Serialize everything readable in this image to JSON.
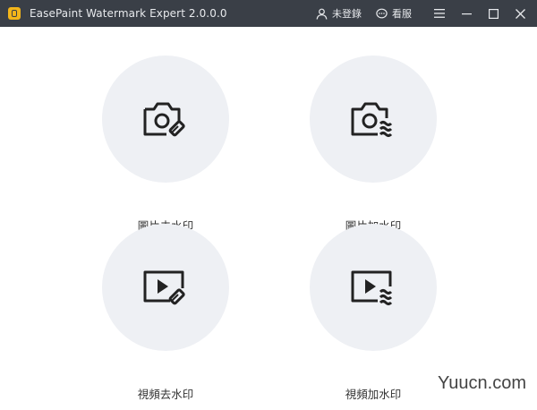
{
  "window": {
    "title": "EasePaint Watermark Expert  2.0.0.0",
    "login_label": "未登錄",
    "feedback_label": "看服"
  },
  "tiles": [
    {
      "label": "圖片去水印",
      "icon": "photo-eraser-icon"
    },
    {
      "label": "圖片加水印",
      "icon": "photo-watermark-icon"
    },
    {
      "label": "視頻去水印",
      "icon": "video-eraser-icon"
    },
    {
      "label": "視頻加水印",
      "icon": "video-watermark-icon"
    }
  ],
  "site_watermark": "Yuucn.com",
  "colors": {
    "titlebar": "#3a3f47",
    "tile_bg": "#eef0f4",
    "logo": "#f3b51a",
    "icon": "#222222"
  }
}
